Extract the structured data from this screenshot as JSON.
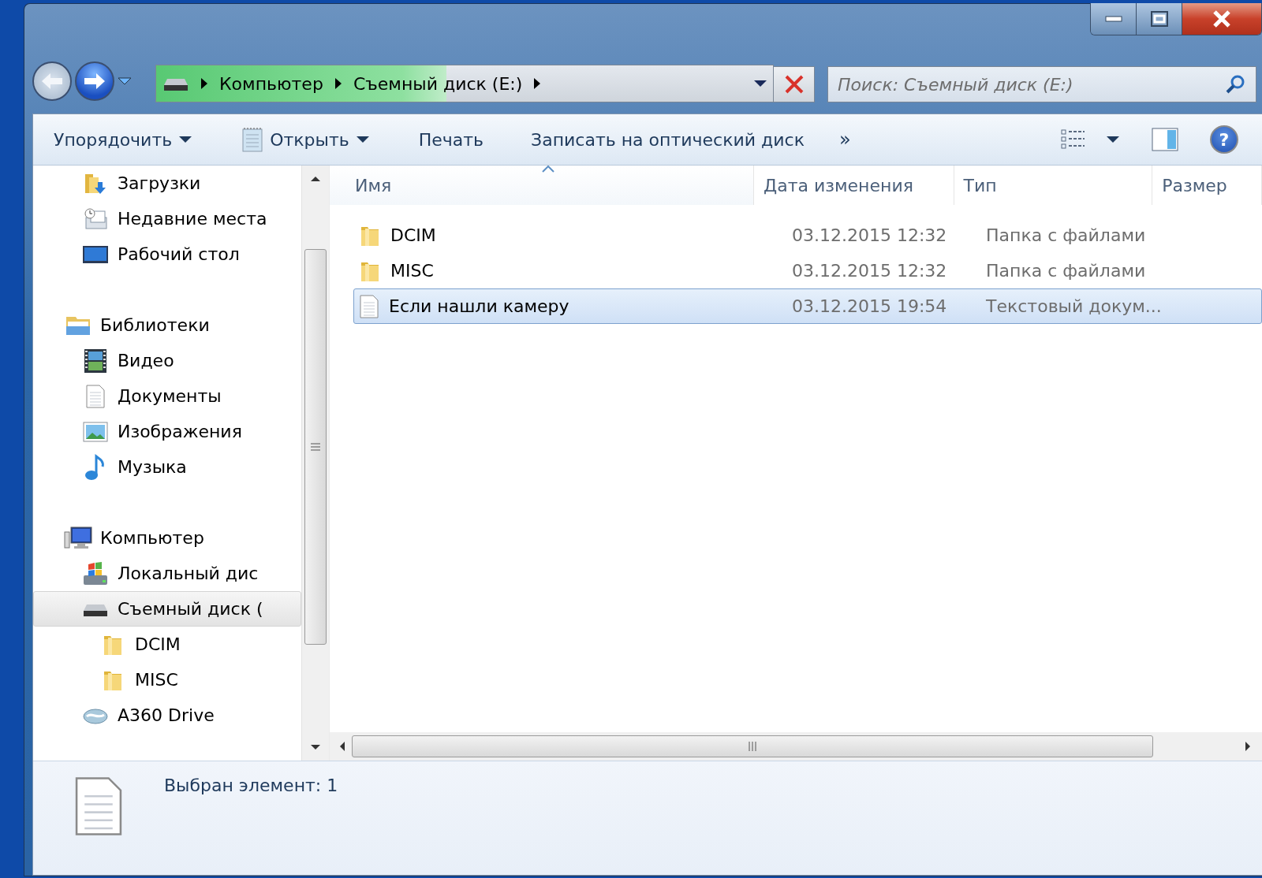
{
  "window": {
    "buttons": [
      {
        "kind": "minimize"
      },
      {
        "kind": "maximize"
      },
      {
        "kind": "close"
      }
    ]
  },
  "address_bar": {
    "segments": [
      "Компьютер",
      "Съемный диск (E:)"
    ],
    "progress": {
      "level": 0.47
    }
  },
  "search": {
    "placeholder": "Поиск: Съемный диск (E:)"
  },
  "toolbar": {
    "items": [
      {
        "label": "Упорядочить",
        "kind": "menu"
      },
      {
        "label": "Открыть",
        "kind": "open"
      },
      {
        "label": "Печать",
        "kind": "plain"
      },
      {
        "label": "Записать на оптический диск",
        "kind": "plain"
      }
    ],
    "overflow": "»",
    "help": "?"
  },
  "sidebar": {
    "sections": [
      {
        "children": [
          {
            "label": "Загрузки",
            "kind": "downloads",
            "selected": false
          },
          {
            "label": "Недавние места",
            "kind": "recent",
            "selected": false
          },
          {
            "label": "Рабочий стол",
            "kind": "desktop",
            "selected": false
          }
        ]
      },
      {
        "label": "Библиотеки",
        "kind": "library",
        "selected": false,
        "children": [
          {
            "label": "Видео",
            "kind": "video",
            "selected": false
          },
          {
            "label": "Документы",
            "kind": "documents",
            "selected": false
          },
          {
            "label": "Изображения",
            "kind": "pictures",
            "selected": false
          },
          {
            "label": "Музыка",
            "kind": "music",
            "selected": false
          }
        ]
      },
      {
        "label": "Компьютер",
        "kind": "computer",
        "selected": false,
        "children": [
          {
            "label": "Локальный дис",
            "kind": "local-disk",
            "selected": false
          },
          {
            "label": "Съемный диск (",
            "kind": "removable",
            "selected": true,
            "children": [
              {
                "label": "DCIM",
                "kind": "folder",
                "selected": false
              },
              {
                "label": "MISC",
                "kind": "folder",
                "selected": false
              }
            ]
          },
          {
            "label": "A360 Drive",
            "kind": "cloud",
            "selected": false
          }
        ]
      }
    ]
  },
  "table": {
    "columns": [
      {
        "label": "Имя",
        "sorted": true
      },
      {
        "label": "Дата изменения",
        "sorted": false
      },
      {
        "label": "Тип",
        "sorted": false
      },
      {
        "label": "Размер",
        "sorted": false
      }
    ],
    "rows": [
      {
        "kind": "folder",
        "name": "DCIM",
        "date": "03.12.2015 12:32",
        "type": "Папка с файлами",
        "selected": false
      },
      {
        "kind": "folder",
        "name": "MISC",
        "date": "03.12.2015 12:32",
        "type": "Папка с файлами",
        "selected": false
      },
      {
        "kind": "text",
        "name": "Если нашли камеру",
        "date": "03.12.2015 19:54",
        "type": "Текстовый докум...",
        "selected": true
      }
    ]
  },
  "status_bar": {
    "text": "Выбран элемент: 1"
  }
}
